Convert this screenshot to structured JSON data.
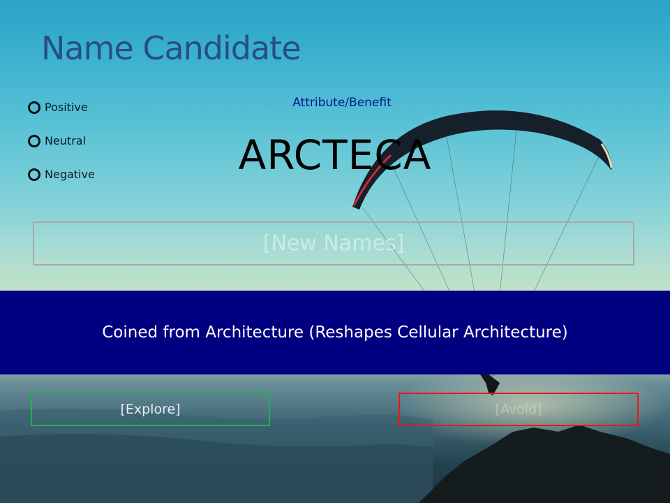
{
  "header": {
    "title": "Name Candidate"
  },
  "ratings": {
    "options": [
      {
        "label": "Positive"
      },
      {
        "label": "Neutral"
      },
      {
        "label": "Negative"
      }
    ]
  },
  "main": {
    "attribute_label": "Attribute/Benefit",
    "candidate_name": "ARCTECA",
    "new_names_placeholder": "[New Names]"
  },
  "banner": {
    "text": "Coined from Architecture (Reshapes Cellular Architecture)",
    "color": "#000080"
  },
  "actions": {
    "explore_label": "[Explore]",
    "avoid_label": "[Avoid]",
    "explore_color": "#1fb34a",
    "avoid_color": "#e81818"
  }
}
